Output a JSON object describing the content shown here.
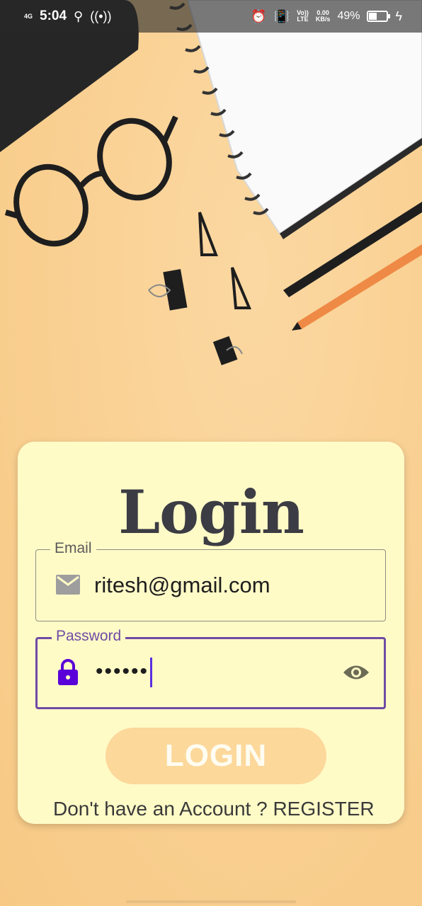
{
  "status_bar": {
    "network": "4G",
    "time": "5:04",
    "volte_top": "Vo))",
    "volte_bottom": "LTE",
    "speed_top": "0.00",
    "speed_bottom": "KB/s",
    "battery_percent": "49%",
    "battery_level": 0.49
  },
  "login_card": {
    "title": "Login",
    "email": {
      "label": "Email",
      "value": "ritesh@gmail.com"
    },
    "password": {
      "label": "Password",
      "masked_value": "••••••"
    },
    "login_button": "LOGIN",
    "register_prompt": "Don't have an Account ?",
    "register_link": "REGISTER"
  },
  "colors": {
    "accent": "#6f4ba5",
    "lock_icon": "#5a00d8",
    "card_bg": "#fffbc7",
    "button_bg": "#fcd89b"
  }
}
